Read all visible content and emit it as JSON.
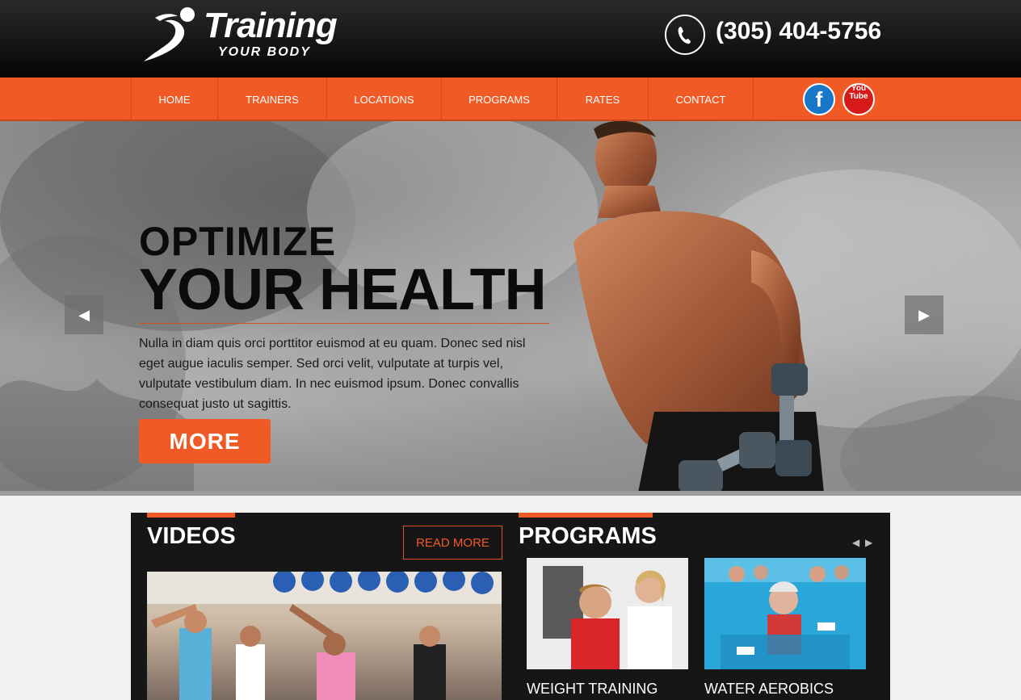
{
  "header": {
    "logo_title": "Training",
    "logo_subtitle": "YOUR BODY",
    "phone": "(305) 404-5756"
  },
  "nav": {
    "items": [
      {
        "label": "HOME"
      },
      {
        "label": "TRAINERS"
      },
      {
        "label": "LOCATIONS"
      },
      {
        "label": "PROGRAMS"
      },
      {
        "label": "RATES"
      },
      {
        "label": "CONTACT"
      }
    ],
    "social": {
      "facebook": "f",
      "youtube_line1": "You",
      "youtube_line2": "Tube"
    }
  },
  "hero": {
    "title_line1": "OPTIMIZE",
    "title_line2": "YOUR HEALTH",
    "body": "Nulla in diam quis orci porttitor euismod at eu quam. Donec sed nisl eget augue iaculis semper. Sed orci velit, vulputate at turpis vel, vulputate vestibulum diam. In nec euismod ipsum. Donec convallis consequat justo ut sagittis.",
    "button": "MORE",
    "prev_icon": "◀",
    "next_icon": "▶"
  },
  "videos": {
    "title": "VIDEOS",
    "read_more": "READ MORE"
  },
  "programs": {
    "title": "PROGRAMS",
    "prev_icon": "◀",
    "next_icon": "▶",
    "items": [
      {
        "label": "WEIGHT TRAINING"
      },
      {
        "label": "WATER AEROBICS"
      }
    ]
  },
  "colors": {
    "accent": "#f05a25",
    "header_bg": "#050505",
    "panel_bg": "#161616",
    "facebook": "#1877c9",
    "youtube": "#d61a1a"
  }
}
